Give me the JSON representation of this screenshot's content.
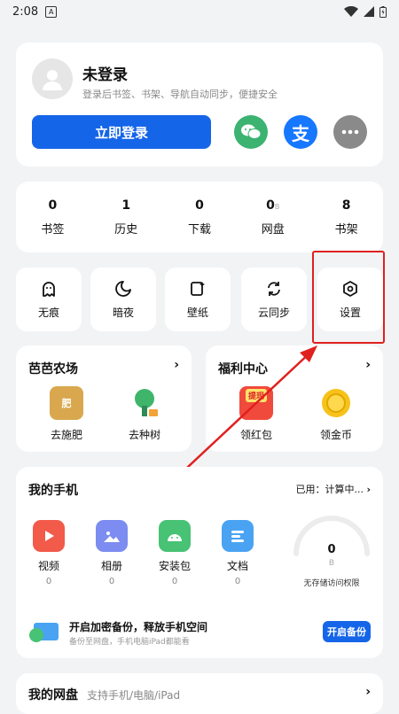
{
  "status_bar": {
    "time": "2:08",
    "notif": "A"
  },
  "profile": {
    "name": "未登录",
    "subtitle": "登录后书签、书架、导航自动同步，便捷安全",
    "login_button": "立即登录",
    "wechat_label": "微信",
    "alipay_label": "支"
  },
  "stats": [
    {
      "value": "0",
      "label": "书签"
    },
    {
      "value": "1",
      "label": "历史"
    },
    {
      "value": "0",
      "label": "下载"
    },
    {
      "value": "0",
      "sub": "B",
      "label": "网盘"
    },
    {
      "value": "8",
      "label": "书架"
    }
  ],
  "tools": [
    {
      "label": "无痕",
      "icon": "ghost-icon"
    },
    {
      "label": "暗夜",
      "icon": "moon-icon"
    },
    {
      "label": "壁纸",
      "icon": "wallpaper-icon"
    },
    {
      "label": "云同步",
      "icon": "sync-icon"
    },
    {
      "label": "设置",
      "icon": "settings-icon"
    }
  ],
  "farm": {
    "title": "芭芭农场",
    "items": [
      {
        "label": "去施肥"
      },
      {
        "label": "去种树"
      }
    ]
  },
  "welfare": {
    "title": "福利中心",
    "items": [
      {
        "label": "领红包",
        "badge": "提现"
      },
      {
        "label": "领金币"
      }
    ]
  },
  "phone": {
    "title": "我的手机",
    "used": "已用：计算中...",
    "apps": [
      {
        "label": "视频",
        "count": "0"
      },
      {
        "label": "相册",
        "count": "0"
      },
      {
        "label": "安装包",
        "count": "0"
      },
      {
        "label": "文档",
        "count": "0"
      }
    ],
    "gauge": {
      "value": "0",
      "sub": "B",
      "label": "无存储访问权限"
    },
    "backup": {
      "title": "开启加密备份，释放手机空间",
      "subtitle": "备份至网盘，手机电脑iPad都能看",
      "button": "开启备份"
    }
  },
  "disk": {
    "title": "我的网盘",
    "subtitle": "支持手机/电脑/iPad"
  },
  "colors": {
    "accent": "#1565e8",
    "highlight": "#e02020",
    "wechat": "#3cb371",
    "alipay": "#1677ff"
  }
}
